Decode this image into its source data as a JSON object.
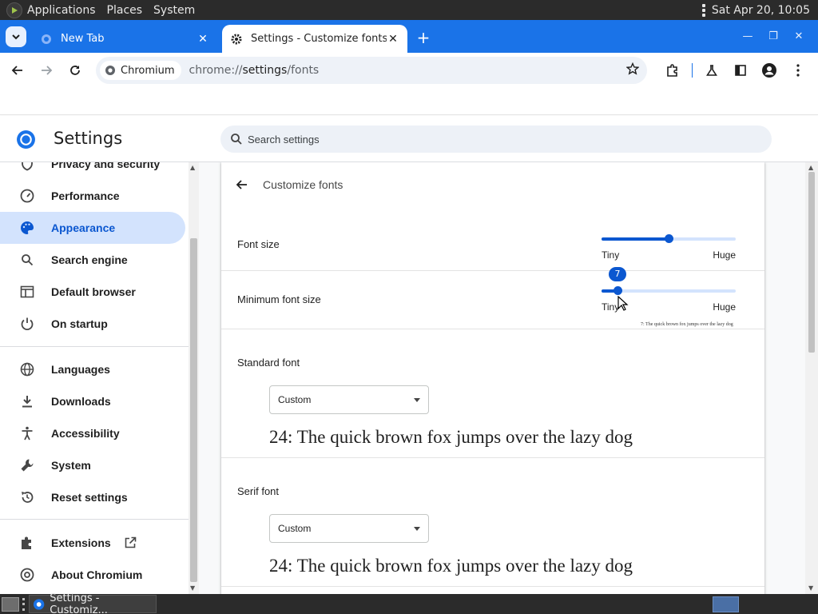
{
  "top_panel": {
    "menus": [
      "Applications",
      "Places",
      "System"
    ],
    "clock": "Sat Apr 20, 10:05"
  },
  "browser": {
    "tabs": [
      {
        "title": "New Tab",
        "active": false
      },
      {
        "title": "Settings - Customize fonts",
        "active": true
      }
    ],
    "chip_label": "Chromium",
    "url_prefix": "chrome://",
    "url_host": "settings",
    "url_path": "/fonts",
    "accent_color": "#1a73e8"
  },
  "settings": {
    "title": "Settings",
    "search_placeholder": "Search settings"
  },
  "sidebar": {
    "items": [
      {
        "label": "Privacy and security",
        "icon": "shield-icon"
      },
      {
        "label": "Performance",
        "icon": "speedometer-icon"
      },
      {
        "label": "Appearance",
        "icon": "palette-icon",
        "selected": true
      },
      {
        "label": "Search engine",
        "icon": "search-icon"
      },
      {
        "label": "Default browser",
        "icon": "browser-window-icon"
      },
      {
        "label": "On startup",
        "icon": "power-icon"
      },
      {
        "label": "Languages",
        "icon": "globe-icon"
      },
      {
        "label": "Downloads",
        "icon": "download-icon"
      },
      {
        "label": "Accessibility",
        "icon": "accessibility-icon"
      },
      {
        "label": "System",
        "icon": "wrench-icon"
      },
      {
        "label": "Reset settings",
        "icon": "reset-icon"
      },
      {
        "label": "Extensions",
        "icon": "puzzle-icon"
      },
      {
        "label": "About Chromium",
        "icon": "chromium-icon"
      }
    ]
  },
  "fonts_page": {
    "heading": "Customize fonts",
    "font_size": {
      "label": "Font size",
      "min_label": "Tiny",
      "max_label": "Huge",
      "value_fraction": 0.5
    },
    "min_font_size": {
      "label": "Minimum font size",
      "min_label": "Tiny",
      "max_label": "Huge",
      "bubble": "7",
      "value_fraction": 0.12,
      "sample": "7: The quick brown fox jumps over the lazy dog"
    },
    "standard_font": {
      "title": "Standard font",
      "selected": "Custom",
      "sample": "24: The quick brown fox jumps over the lazy dog"
    },
    "serif_font": {
      "title": "Serif font",
      "selected": "Custom",
      "sample": "24: The quick brown fox jumps over the lazy dog"
    }
  },
  "taskbar": {
    "window_title": "Settings - Customiz..."
  }
}
